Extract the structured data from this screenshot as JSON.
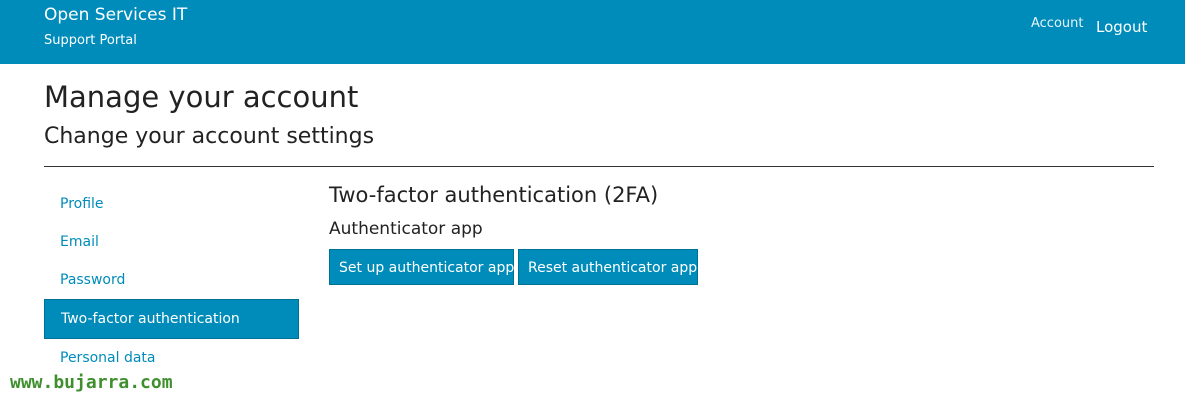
{
  "navbar": {
    "brand_title": "Open Services IT",
    "brand_subtitle": "Support Portal",
    "account_link": "Account",
    "logout_link": "Logout",
    "background_color": "#008cba"
  },
  "page": {
    "title": "Manage your account",
    "subtitle": "Change your account settings"
  },
  "sidebar": {
    "items": [
      {
        "label": "Profile",
        "active": false
      },
      {
        "label": "Email",
        "active": false
      },
      {
        "label": "Password",
        "active": false
      },
      {
        "label": "Two-factor authentication",
        "active": true
      },
      {
        "label": "Personal data",
        "active": false
      }
    ]
  },
  "main": {
    "heading": "Two-factor authentication (2FA)",
    "subheading": "Authenticator app",
    "setup_button": "Set up authenticator app",
    "reset_button": "Reset authenticator app"
  },
  "watermark": "www.bujarra.com",
  "colors": {
    "accent": "#008cba",
    "watermark": "#3f8f2f"
  }
}
